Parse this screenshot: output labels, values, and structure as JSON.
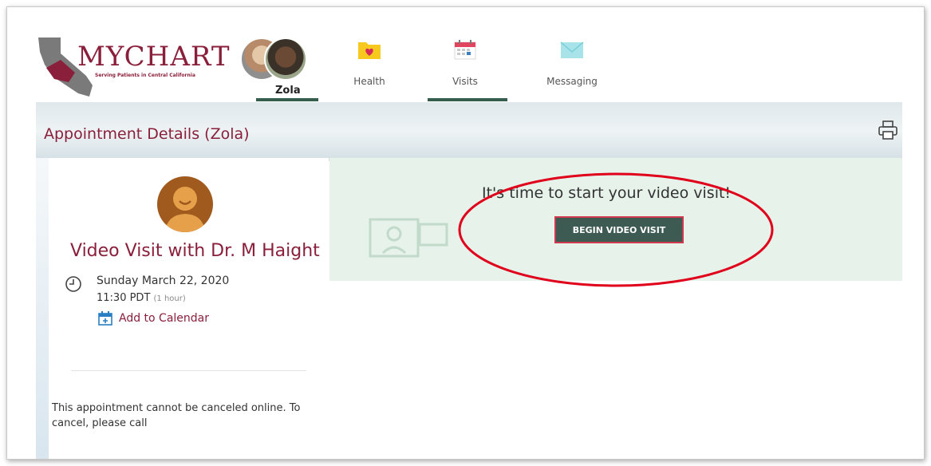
{
  "app": {
    "logo_title": "MYCHART",
    "logo_subtitle": "Serving Patients in Central California"
  },
  "header": {
    "patient_name": "Zola",
    "nav": [
      {
        "label": "Health",
        "icon": "folder-heart-icon"
      },
      {
        "label": "Visits",
        "icon": "calendar-icon"
      },
      {
        "label": "Messaging",
        "icon": "envelope-icon"
      }
    ]
  },
  "page": {
    "title": "Appointment Details (Zola)"
  },
  "appointment": {
    "title": "Video Visit with Dr. M Haight",
    "date": "Sunday March 22, 2020",
    "time": "11:30 PDT",
    "duration": "(1 hour)",
    "add_to_calendar": "Add to Calendar",
    "cancel_note": "This appointment cannot be canceled online. To cancel, please call"
  },
  "video": {
    "message": "It's time to start your video visit!",
    "button_label": "BEGIN VIDEO VISIT"
  },
  "colors": {
    "brand": "#8a1f3b",
    "nav_underline": "#355e4f",
    "button_bg": "#3d5b52",
    "highlight": "#e0001b",
    "panel_green": "#e6f2ea"
  }
}
